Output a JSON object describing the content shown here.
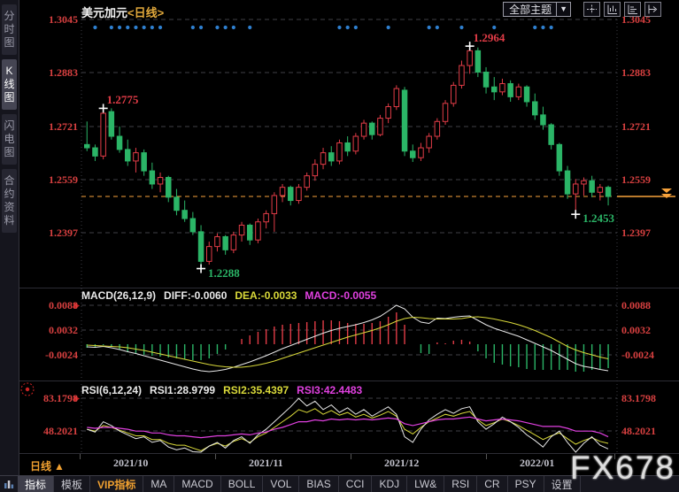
{
  "header": {
    "symbol": "美元加元",
    "period_tag": "<日线>",
    "theme_dropdown": "全部主题",
    "theme_dropdown_arrow": "▼"
  },
  "sidebar": {
    "tabs": [
      {
        "label": "分时图",
        "selected": false
      },
      {
        "label": "K线图",
        "selected": true
      },
      {
        "label": "闪电图",
        "selected": false
      },
      {
        "label": "合约资料",
        "selected": false
      }
    ]
  },
  "macd_panel": {
    "title": "MACD(26,12,9)",
    "diff_label": "DIFF:-0.0060",
    "dea_label": "DEA:-0.0033",
    "macd_label": "MACD:-0.0055"
  },
  "rsi_panel": {
    "title": "RSI(6,12,24)",
    "rsi1_label": "RSI1:28.9799",
    "rsi2_label": "RSI2:35.4397",
    "rsi3_label": "RSI3:42.4483"
  },
  "x_axis": {
    "period_label": "日线",
    "period_arrow": "▲",
    "dates": [
      "2021/10",
      "2021/11",
      "2021/12",
      "2022/01"
    ]
  },
  "watermark": "FX678",
  "toolbar": {
    "items": [
      {
        "label": "指标",
        "selected": true,
        "vip": false
      },
      {
        "label": "模板",
        "selected": false,
        "vip": false
      },
      {
        "label": "VIP指标",
        "selected": false,
        "vip": true
      },
      {
        "label": "MA",
        "selected": false,
        "vip": false
      },
      {
        "label": "MACD",
        "selected": false,
        "vip": false
      },
      {
        "label": "BOLL",
        "selected": false,
        "vip": false
      },
      {
        "label": "VOL",
        "selected": false,
        "vip": false
      },
      {
        "label": "BIAS",
        "selected": false,
        "vip": false
      },
      {
        "label": "CCI",
        "selected": false,
        "vip": false
      },
      {
        "label": "KDJ",
        "selected": false,
        "vip": false
      },
      {
        "label": "LW&",
        "selected": false,
        "vip": false
      },
      {
        "label": "RSI",
        "selected": false,
        "vip": false
      },
      {
        "label": "CR",
        "selected": false,
        "vip": false
      },
      {
        "label": "PSY",
        "selected": false,
        "vip": false
      },
      {
        "label": "设置",
        "selected": false,
        "vip": false
      }
    ]
  },
  "colors": {
    "up": "#e23c47",
    "down": "#2bb567",
    "axis_text": "#d84040",
    "accent_orange": "#f7a23b",
    "signal_dot": "#2f80d0",
    "diff_line": "#e8e8e8",
    "dea_line": "#d9d93a",
    "macd_line": "#e040e0",
    "rsi1": "#e8e8e8",
    "rsi2": "#d9d93a",
    "rsi3": "#e040e0",
    "grid": "#3f3f46"
  },
  "chart_data": {
    "type": "candlestick",
    "title": "美元加元 日线 (USD/CAD daily) with MACD(26,12,9) and RSI(6,12,24)",
    "axis_labels": {
      "main": [
        "1.3045",
        "1.2883",
        "1.2721",
        "1.2559",
        "1.2397"
      ],
      "macd": [
        "0.0088",
        "0.0032",
        "-0.0024"
      ],
      "rsi": [
        "83.1798",
        "48.2021"
      ]
    },
    "price_axis_range": [
      1.2397,
      1.3045
    ],
    "current_price": 1.2507,
    "x_dates": [
      "2021/10",
      "2021/11",
      "2021/12",
      "2022/01"
    ],
    "candles": [
      [
        1.2665,
        1.2735,
        1.2645,
        1.2655
      ],
      [
        1.2655,
        1.2665,
        1.2615,
        1.263
      ],
      [
        1.263,
        1.2775,
        1.262,
        1.276
      ],
      [
        1.2765,
        1.2775,
        1.268,
        1.269
      ],
      [
        1.269,
        1.272,
        1.264,
        1.265
      ],
      [
        1.265,
        1.268,
        1.26,
        1.2615
      ],
      [
        1.2615,
        1.2655,
        1.258,
        1.264
      ],
      [
        1.264,
        1.265,
        1.257,
        1.2585
      ],
      [
        1.2585,
        1.261,
        1.253,
        1.2545
      ],
      [
        1.2545,
        1.258,
        1.252,
        1.2565
      ],
      [
        1.2565,
        1.257,
        1.249,
        1.2505
      ],
      [
        1.2505,
        1.253,
        1.245,
        1.2465
      ],
      [
        1.2465,
        1.2495,
        1.243,
        1.244
      ],
      [
        1.244,
        1.246,
        1.239,
        1.24
      ],
      [
        1.24,
        1.242,
        1.2288,
        1.231
      ],
      [
        1.231,
        1.237,
        1.23,
        1.2355
      ],
      [
        1.2355,
        1.2395,
        1.234,
        1.2385
      ],
      [
        1.2385,
        1.239,
        1.233,
        1.2345
      ],
      [
        1.2345,
        1.24,
        1.2335,
        1.239
      ],
      [
        1.239,
        1.243,
        1.237,
        1.242
      ],
      [
        1.242,
        1.2425,
        1.236,
        1.2375
      ],
      [
        1.2375,
        1.244,
        1.2365,
        1.243
      ],
      [
        1.243,
        1.2465,
        1.241,
        1.2455
      ],
      [
        1.2455,
        1.252,
        1.24,
        1.251
      ],
      [
        1.251,
        1.2545,
        1.249,
        1.2535
      ],
      [
        1.2535,
        1.254,
        1.248,
        1.2495
      ],
      [
        1.2495,
        1.2545,
        1.2485,
        1.2535
      ],
      [
        1.2535,
        1.258,
        1.2525,
        1.257
      ],
      [
        1.257,
        1.262,
        1.2555,
        1.2605
      ],
      [
        1.2605,
        1.2655,
        1.259,
        1.264
      ],
      [
        1.264,
        1.266,
        1.26,
        1.2615
      ],
      [
        1.2615,
        1.268,
        1.2605,
        1.267
      ],
      [
        1.267,
        1.269,
        1.263,
        1.2645
      ],
      [
        1.2645,
        1.27,
        1.2635,
        1.269
      ],
      [
        1.269,
        1.274,
        1.268,
        1.273
      ],
      [
        1.273,
        1.2735,
        1.268,
        1.2695
      ],
      [
        1.2695,
        1.2755,
        1.269,
        1.2745
      ],
      [
        1.2745,
        1.279,
        1.273,
        1.278
      ],
      [
        1.278,
        1.2845,
        1.277,
        1.2835
      ],
      [
        1.283,
        1.284,
        1.263,
        1.2645
      ],
      [
        1.2645,
        1.2665,
        1.2612,
        1.2625
      ],
      [
        1.2625,
        1.267,
        1.2615,
        1.2655
      ],
      [
        1.2655,
        1.27,
        1.264,
        1.269
      ],
      [
        1.269,
        1.2745,
        1.268,
        1.2735
      ],
      [
        1.2735,
        1.28,
        1.2725,
        1.279
      ],
      [
        1.279,
        1.2855,
        1.278,
        1.2845
      ],
      [
        1.2845,
        1.292,
        1.2835,
        1.2905
      ],
      [
        1.2905,
        1.2964,
        1.288,
        1.295
      ],
      [
        1.295,
        1.296,
        1.287,
        1.2885
      ],
      [
        1.2885,
        1.29,
        1.282,
        1.284
      ],
      [
        1.284,
        1.287,
        1.28,
        1.2825
      ],
      [
        1.2825,
        1.2865,
        1.2815,
        1.285
      ],
      [
        1.285,
        1.286,
        1.2795,
        1.281
      ],
      [
        1.281,
        1.285,
        1.28,
        1.284
      ],
      [
        1.284,
        1.2845,
        1.278,
        1.2795
      ],
      [
        1.2795,
        1.282,
        1.274,
        1.2755
      ],
      [
        1.2755,
        1.278,
        1.271,
        1.2725
      ],
      [
        1.2725,
        1.273,
        1.265,
        1.2665
      ],
      [
        1.2665,
        1.267,
        1.257,
        1.2585
      ],
      [
        1.2585,
        1.26,
        1.25,
        1.2515
      ],
      [
        1.2515,
        1.256,
        1.2453,
        1.2545
      ],
      [
        1.2545,
        1.2565,
        1.251,
        1.2555
      ],
      [
        1.2555,
        1.257,
        1.2505,
        1.252
      ],
      [
        1.252,
        1.2545,
        1.2495,
        1.2535
      ],
      [
        1.2535,
        1.254,
        1.248,
        1.2507
      ]
    ],
    "signal_dot_indices": [
      1,
      3,
      4,
      5,
      6,
      7,
      8,
      9,
      13,
      14,
      16,
      17,
      18,
      20,
      31,
      32,
      33,
      37,
      42,
      43,
      46,
      50,
      55,
      56,
      57
    ],
    "annotations": [
      {
        "label": "1.2775",
        "index": 2,
        "price": 1.2775,
        "side": "high",
        "color": "red"
      },
      {
        "label": "1.2288",
        "index": 14,
        "price": 1.2288,
        "side": "low",
        "color": "green"
      },
      {
        "label": "1.2964",
        "index": 47,
        "price": 1.2964,
        "side": "high",
        "color": "red"
      },
      {
        "label": "1.2453",
        "index": 60,
        "price": 1.2453,
        "side": "low",
        "color": "green"
      }
    ],
    "macd": {
      "diff": [
        -0.0006,
        -0.0007,
        -0.0005,
        -0.0008,
        -0.0012,
        -0.0017,
        -0.0021,
        -0.0026,
        -0.0031,
        -0.0036,
        -0.0041,
        -0.0046,
        -0.0051,
        -0.0056,
        -0.006,
        -0.0062,
        -0.006,
        -0.0057,
        -0.0052,
        -0.0046,
        -0.004,
        -0.0033,
        -0.0026,
        -0.0018,
        -0.001,
        -0.0003,
        0.0004,
        0.0011,
        0.0018,
        0.0025,
        0.0031,
        0.0036,
        0.004,
        0.0044,
        0.0049,
        0.0055,
        0.0063,
        0.0075,
        0.0088,
        0.008,
        0.0061,
        0.005,
        0.0047,
        0.0059,
        0.0058,
        0.0061,
        0.0063,
        0.0064,
        0.0054,
        0.0044,
        0.0036,
        0.003,
        0.0024,
        0.0018,
        0.001,
        0.0002,
        -0.0006,
        -0.0014,
        -0.0024,
        -0.0034,
        -0.0044,
        -0.005,
        -0.0053,
        -0.0057,
        -0.006
      ],
      "dea": [
        -0.0002,
        -0.0003,
        -0.0004,
        -0.0005,
        -0.0006,
        -0.0008,
        -0.0011,
        -0.0014,
        -0.0018,
        -0.0022,
        -0.0026,
        -0.003,
        -0.0034,
        -0.0038,
        -0.0042,
        -0.0046,
        -0.0049,
        -0.0051,
        -0.0052,
        -0.0052,
        -0.005,
        -0.0047,
        -0.0043,
        -0.0038,
        -0.0032,
        -0.0026,
        -0.002,
        -0.0014,
        -0.0008,
        -0.0002,
        0.0004,
        0.001,
        0.0016,
        0.0021,
        0.0026,
        0.0031,
        0.0037,
        0.0044,
        0.0052,
        0.0058,
        0.0061,
        0.006,
        0.0058,
        0.0057,
        0.0057,
        0.0057,
        0.0058,
        0.0061,
        0.0062,
        0.006,
        0.0057,
        0.0053,
        0.0049,
        0.0044,
        0.0038,
        0.0031,
        0.0023,
        0.0015,
        0.0005,
        -0.0005,
        -0.0013,
        -0.0019,
        -0.0024,
        -0.0029,
        -0.0033
      ]
    },
    "rsi": {
      "rsi1": [
        50,
        47,
        58,
        54,
        48,
        44,
        40,
        42,
        36,
        38,
        31,
        28,
        30,
        26,
        22,
        32,
        36,
        30,
        38,
        42,
        35,
        44,
        50,
        58,
        66,
        74,
        83,
        75,
        80,
        71,
        76,
        68,
        73,
        66,
        71,
        64,
        69,
        74,
        66,
        42,
        36,
        50,
        60,
        66,
        71,
        67,
        72,
        74,
        58,
        50,
        56,
        63,
        58,
        52,
        44,
        38,
        31,
        42,
        48,
        36,
        25,
        35,
        42,
        33,
        29
      ],
      "rsi2": [
        50,
        48,
        54,
        52,
        49,
        46,
        43,
        43,
        39,
        39,
        35,
        33,
        33,
        30,
        27,
        32,
        35,
        32,
        37,
        40,
        36,
        42,
        46,
        52,
        58,
        64,
        71,
        68,
        72,
        66,
        70,
        65,
        68,
        63,
        66,
        62,
        65,
        69,
        64,
        50,
        45,
        52,
        58,
        62,
        66,
        64,
        67,
        69,
        60,
        54,
        57,
        61,
        58,
        54,
        49,
        44,
        39,
        43,
        46,
        40,
        34,
        38,
        41,
        37,
        35
      ],
      "rsi3": [
        52,
        51,
        52,
        52,
        51,
        50,
        48,
        48,
        46,
        46,
        44,
        43,
        43,
        42,
        41,
        42,
        43,
        43,
        44,
        45,
        44,
        46,
        47,
        50,
        52,
        55,
        58,
        58,
        60,
        59,
        61,
        60,
        61,
        60,
        61,
        60,
        61,
        62,
        61,
        56,
        54,
        56,
        58,
        60,
        61,
        61,
        62,
        63,
        61,
        59,
        60,
        61,
        60,
        59,
        57,
        55,
        53,
        53,
        53,
        51,
        48,
        48,
        48,
        46,
        42
      ]
    }
  }
}
